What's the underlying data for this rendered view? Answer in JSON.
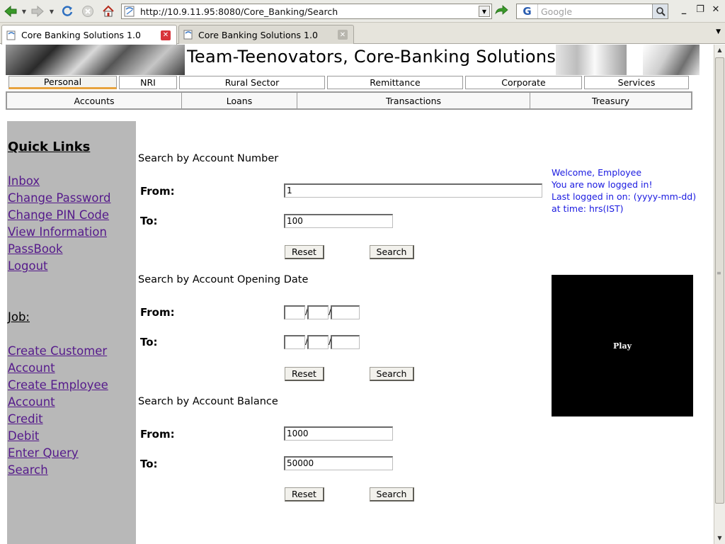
{
  "browser": {
    "url": "http://10.9.11.95:8080/Core_Banking/Search",
    "search_engine_glyph": "G",
    "search_placeholder": "Google",
    "tabs": [
      {
        "label": "Core Banking Solutions 1.0",
        "active": true
      },
      {
        "label": "Core Banking Solutions 1.0",
        "active": false
      }
    ]
  },
  "banner": {
    "title": "Team-Teenovators, Core-Banking Solutions"
  },
  "menu_top": [
    "Personal",
    "NRI",
    "Rural Sector",
    "Remittance",
    "Corporate",
    "Services"
  ],
  "menu_sub": [
    "Accounts",
    "Loans",
    "Transactions",
    "Treasury"
  ],
  "sidebar": {
    "quick_links_title": "Quick Links",
    "quick_links": [
      "Inbox",
      "Change Password",
      "Change PIN Code",
      "View Information",
      "PassBook",
      "Logout"
    ],
    "job_title": "Job:",
    "job_links": [
      "Create Customer",
      "Account",
      "Create Employee",
      "Account",
      "Credit",
      "Debit",
      "Enter Query",
      "Search"
    ]
  },
  "labels": {
    "from": "From:",
    "to": "To:",
    "reset": "Reset",
    "search": "Search",
    "date_sep": "/"
  },
  "sections": {
    "account_number": {
      "title": "Search by Account Number",
      "from_value": "1",
      "to_value": "100"
    },
    "opening_date": {
      "title": "Search by Account Opening Date"
    },
    "balance": {
      "title": "Search by Account Balance",
      "from_value": "1000",
      "to_value": "50000"
    }
  },
  "welcome": {
    "line1": "Welcome, Employee",
    "line2": "You are now logged in!",
    "line3": "Last logged in on: (yyyy-mm-dd)",
    "line4": "at time: hrs(IST)"
  },
  "player": {
    "label": "Play"
  }
}
